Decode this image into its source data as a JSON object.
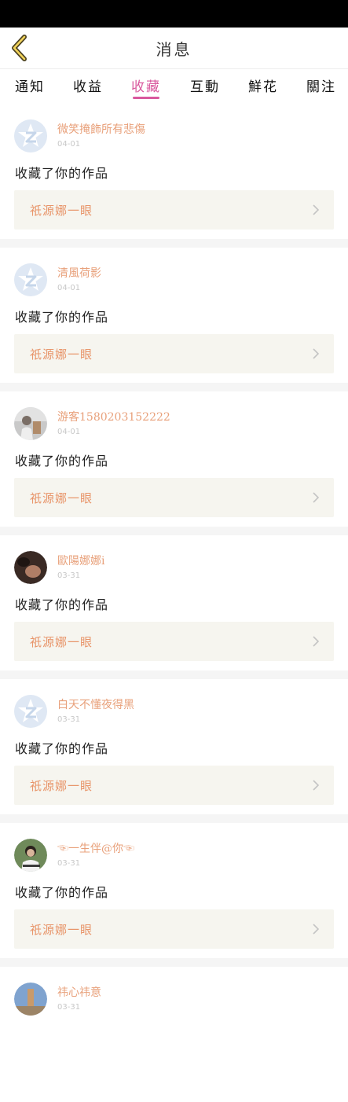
{
  "header": {
    "title": "消息"
  },
  "tabs": [
    {
      "label": "通知"
    },
    {
      "label": "收益"
    },
    {
      "label": "收藏"
    },
    {
      "label": "互動"
    },
    {
      "label": "鮮花"
    },
    {
      "label": "關注"
    }
  ],
  "active_tab": "收藏",
  "accent_color": "#d9589e",
  "messages": [
    {
      "user": "微笑掩飾所有悲傷",
      "date": "04-01",
      "action": "收藏了你的作品",
      "work": "祇源娜一眼",
      "avatar": "default-star-avatar"
    },
    {
      "user": "清風荷影",
      "date": "04-01",
      "action": "收藏了你的作品",
      "work": "祇源娜一眼",
      "avatar": "default-star-avatar"
    },
    {
      "user": "游客1580203152222",
      "date": "04-01",
      "action": "收藏了你的作品",
      "work": "祇源娜一眼",
      "avatar": "photo-avatar"
    },
    {
      "user": "歐陽娜娜i",
      "date": "03-31",
      "action": "收藏了你的作品",
      "work": "祇源娜一眼",
      "avatar": "photo-avatar"
    },
    {
      "user": "白天不懂夜得黑",
      "date": "03-31",
      "action": "收藏了你的作品",
      "work": "祇源娜一眼",
      "avatar": "default-star-avatar"
    },
    {
      "user": "☜一生伴@你☜",
      "date": "03-31",
      "action": "收藏了你的作品",
      "work": "祇源娜一眼",
      "avatar": "photo-avatar"
    },
    {
      "user": "祎心祎意",
      "date": "03-31",
      "action": "",
      "work": "",
      "avatar": "photo-avatar"
    }
  ]
}
